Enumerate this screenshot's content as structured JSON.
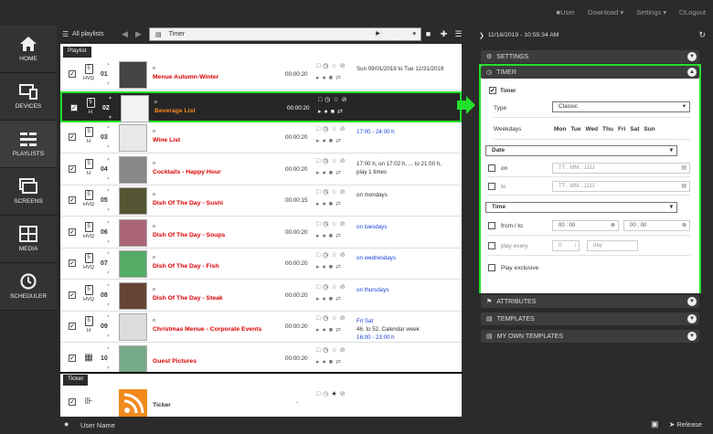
{
  "topnav": {
    "user": "User",
    "download": "Download",
    "settings": "Settings",
    "logout": "Logout"
  },
  "sidebar": {
    "items": [
      {
        "label": "HOME",
        "icon": "home-icon"
      },
      {
        "label": "DEVICES",
        "icon": "devices-icon"
      },
      {
        "label": "PLAYLISTS",
        "icon": "playlists-icon"
      },
      {
        "label": "SCREENS",
        "icon": "screens-icon"
      },
      {
        "label": "MEDIA",
        "icon": "media-icon"
      },
      {
        "label": "SCHEDULER",
        "icon": "clock-icon"
      }
    ]
  },
  "playlist_header": {
    "all": "All playlists",
    "selected": "Timer"
  },
  "playlist_tag": "Playlist",
  "ticker_tag": "Ticker",
  "rows": [
    {
      "type": "HVQ",
      "num": "01",
      "dot": "o",
      "name": "Menue Autumn-Winter",
      "dur": "00:00:20",
      "sched": [
        "Sun 09/01/2019 to Tue 12/31/2019"
      ],
      "blue": []
    },
    {
      "type": "H",
      "num": "02",
      "dot": "o",
      "name": "Beverage List",
      "dur": "00:00:20",
      "sched": [],
      "blue": []
    },
    {
      "type": "H",
      "num": "03",
      "dot": "o",
      "name": "Wine List",
      "dur": "00:00:20",
      "sched": [
        "17:00 - 24:00 h"
      ],
      "blue": [
        0
      ]
    },
    {
      "type": "H",
      "num": "04",
      "dot": "o",
      "name": "Cocktails - Happy Hour",
      "dur": "00:00:20",
      "sched": [
        "17:00 h, on 17:02 h, ... to 21:00 h,",
        "play 1 times"
      ],
      "blue": []
    },
    {
      "type": "HVQ",
      "num": "05",
      "dot": "o",
      "name": "Dish Of The Day - Sushi",
      "dur": "00:00:15",
      "sched": [
        "on mondays"
      ],
      "blue": []
    },
    {
      "type": "HVQ",
      "num": "06",
      "dot": "o",
      "name": "Dish Of The Day - Soups",
      "dur": "00:00:20",
      "sched": [
        "on tuesdays"
      ],
      "blue": [
        0
      ]
    },
    {
      "type": "HVQ",
      "num": "07",
      "dot": "o",
      "name": "Dish Of The Day - Fish",
      "dur": "00:00:20",
      "sched": [
        "on wednesdays"
      ],
      "blue": [
        0
      ]
    },
    {
      "type": "HVQ",
      "num": "08",
      "dot": "o",
      "name": "Dish Of The Day - Steak",
      "dur": "00:00:20",
      "sched": [
        "on thursdays"
      ],
      "blue": [
        0
      ]
    },
    {
      "type": "H",
      "num": "09",
      "dot": "o",
      "name": "Christmas Menue - Corporate Events",
      "dur": "00:00:20",
      "sched": [
        "Fri Sat",
        "46. to 52. Calendar week",
        "16:00 - 23:00 h"
      ],
      "blue": [
        0,
        2
      ]
    },
    {
      "type": "",
      "num": "10",
      "dot": "",
      "name": "Guest Pictures",
      "dur": "00:00:20",
      "sched": [],
      "blue": []
    }
  ],
  "ticker_row": {
    "num": "",
    "name": "Ticker",
    "dur": "-"
  },
  "right": {
    "datetime": "11/18/2019 - 10:55:34 AM",
    "settings": "SETTINGS",
    "timer": "TIMER",
    "timer_check": "Timer",
    "type_label": "Type",
    "type_value": "Classic",
    "weekdays_label": "Weekdays",
    "weekdays": [
      "Mon",
      "Tue",
      "Wed",
      "Thu",
      "Fri",
      "Sat",
      "Sun"
    ],
    "date_label": "Date",
    "on_label": "on",
    "to_label": "to",
    "date_placeholder": "TT . MM . JJJJ",
    "time_label": "Time",
    "from_to_label": "from / to",
    "time_value": "00 : 00",
    "play_every_label": "play every",
    "play_every_value": "0",
    "play_every_unit": "day",
    "play_exclusive_label": "Play exclusive",
    "attributes": "ATTRIBUTES",
    "templates": "TEMPLATES",
    "my_templates": "MY OWN TEMPLATES"
  },
  "bottom": {
    "user": "User Name",
    "release": "Release"
  },
  "colors": {
    "accent": "#22e02a",
    "name_red": "#d90000",
    "blue": "#1a3fd8",
    "selected_name": "#ff8a1a"
  }
}
